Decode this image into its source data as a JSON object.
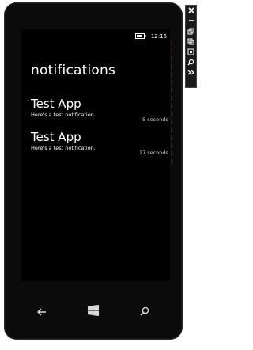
{
  "status_bar": {
    "time": "12:16"
  },
  "page": {
    "title": "notifications"
  },
  "notifications": [
    {
      "app": "Test App",
      "message": "Here's a test notification.",
      "time": "5 seconds ago"
    },
    {
      "app": "Test App",
      "message": "Here's a test notification.",
      "time": "27 seconds ago"
    }
  ],
  "hardware_buttons": {
    "back": "back-icon",
    "start": "windows-logo-icon",
    "search": "search-icon"
  },
  "emulator_toolbar": {
    "icons": [
      "close-icon",
      "minimize-icon",
      "rotate-left-icon",
      "rotate-right-icon",
      "fit-to-screen-icon",
      "zoom-icon",
      "more-tools-icon"
    ]
  },
  "colors": {
    "phone_body": "#0b0b0b",
    "screen": "#000000",
    "text": "#ffffff",
    "toolbar": "#1a1a1a"
  }
}
